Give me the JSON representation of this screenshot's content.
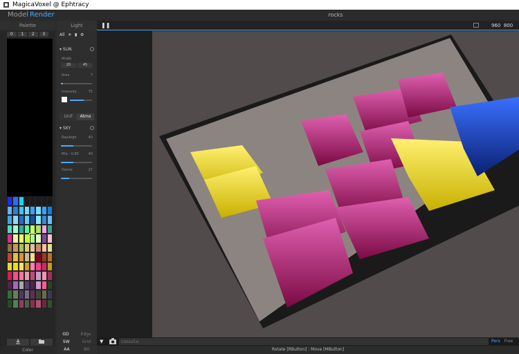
{
  "window": {
    "title": "MagicaVoxel @ Ephtracy"
  },
  "menu": {
    "model": "Model",
    "render": "Render",
    "filename": "rocks"
  },
  "palette": {
    "title": "Palette",
    "tabs": [
      "0",
      "1",
      "2",
      "3"
    ],
    "colors": [
      "#1a2cff",
      "#2a6cff",
      "#1bd4ff",
      "#1a1a1a",
      "#1a1a1a",
      "#1a1a1a",
      "#1a1a1a",
      "#1a1a1a",
      "#5ab8ff",
      "#2a7fd8",
      "#3cc8ff",
      "#7ad8ff",
      "#4a9cff",
      "#72e0ff",
      "#3aa0ff",
      "#1a7ae0",
      "#3fa4e8",
      "#8dd8ff",
      "#2b68c7",
      "#5fcfff",
      "#1b4ca0",
      "#88e8ff",
      "#3c8ad0",
      "#6fbfff",
      "#48e0c0",
      "#9fffcf",
      "#2bb0a0",
      "#5ff5a0",
      "#c8ff5a",
      "#b0e060",
      "#ff9ff0",
      "#3aa48c",
      "#e02a8a",
      "#f0f0a0",
      "#e8ff60",
      "#c0ff40",
      "#b0f090",
      "#e0ffc0",
      "#7a4aa0",
      "#ffbfd0",
      "#907040",
      "#c89a5a",
      "#a8c060",
      "#d8d070",
      "#e0c0a0",
      "#c88a70",
      "#ffc0a0",
      "#e0e090",
      "#c04a2a",
      "#e0c040",
      "#e09030",
      "#c8b8a0",
      "#f0e080",
      "#800020",
      "#9a3a20",
      "#b87030",
      "#e0e020",
      "#f0e000",
      "#ffe060",
      "#d0a020",
      "#ff80b0",
      "#ff3a8a",
      "#e02060",
      "#c09a20",
      "#d81a5a",
      "#ff4a8a",
      "#ff70a0",
      "#e89ab0",
      "#c04a80",
      "#c0a0c0",
      "#ff90b0",
      "#a03060",
      "#5a2050",
      "#a06ac0",
      "#a8a8a8",
      "#603a7a",
      "#4a2a4a",
      "#d09ad0",
      "#ff5a90",
      "#204a20",
      "#3a6a3a",
      "#6a7a60",
      "#4a3a60",
      "#7a6a8a",
      "#603050",
      "#3a4a3a",
      "#6a6a4a",
      "#3a3a5a",
      "#2a4a2a",
      "#5a7a5a",
      "#8a4060",
      "#4a604a",
      "#8a3050",
      "#b05070",
      "#6a2a40",
      "#305030"
    ],
    "import_icon": "import-icon",
    "folder_icon": "folder-icon",
    "footer": "Color"
  },
  "light": {
    "title": "Light",
    "filter_all": "All",
    "sun": {
      "label": "SUN",
      "angle_label": "Angle",
      "angle_1": "20",
      "angle_2": "45",
      "area_label": "Area",
      "area_value": "7",
      "intensity_label": "Intensity",
      "intensity_value": "75"
    },
    "mode_unif": "Unif",
    "mode_atmo": "Atmo",
    "sky": {
      "label": "SKY",
      "rayleigh_label": "Rayleigh",
      "rayleigh_value": "40",
      "mie_label": "Mie - 0.85",
      "mie_value": "40",
      "ozone_label": "Ozone",
      "ozone_value": "27"
    },
    "bottom_rows": [
      [
        "GD",
        "Edge"
      ],
      [
        "SW",
        "Grid"
      ],
      [
        "AA",
        "BG"
      ]
    ]
  },
  "viewport": {
    "render_size_w": "960",
    "render_size_h": "800"
  },
  "console": {
    "placeholder": "console",
    "modes": [
      "Pers",
      "Free",
      "Or"
    ],
    "active_mode": "Pers"
  },
  "status": "Rotate [RButton] : Move [MButton]",
  "scene_colors": {
    "magenta": "#b8206e",
    "yellow": "#f0e010",
    "blue": "#1638a8",
    "floor": "#8c8480",
    "bg": "#514b4b"
  }
}
